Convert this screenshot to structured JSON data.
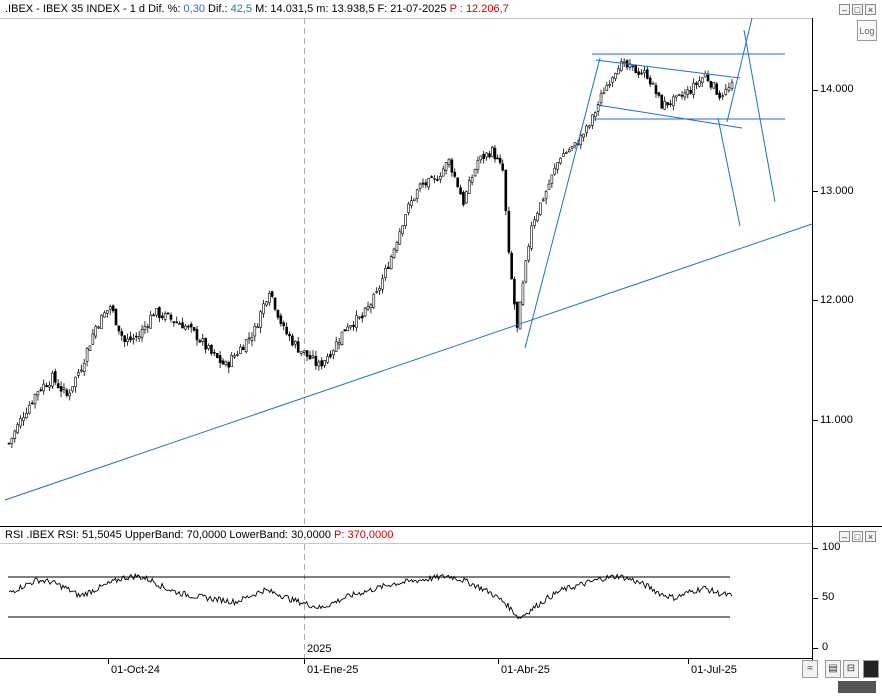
{
  "header": {
    "symbol": ".IBEX - IBEX 35 INDEX -  1 d",
    "dif_pct_label": "Dif. %:",
    "dif_pct": "0,30",
    "dif_label": "Dif.:",
    "dif": "42,5",
    "max": "M: 14.031,5",
    "min": "m: 13.938,5",
    "date": "F: 21-07-2025",
    "p_label": "P :",
    "p_value": "12.206,7"
  },
  "log_button": "Log",
  "rsi_header": {
    "text": "RSI .IBEX RSI: 51,5045  UpperBand: 70,0000  LowerBand: 30,0000",
    "p_label": "P:",
    "p_value": "370,0000"
  },
  "year_marker": "2025",
  "colors": {
    "trendline": "#1f6fd0",
    "price": "#000000",
    "red": "#d00000"
  },
  "chart_data": [
    {
      "type": "candlestick",
      "title": ".IBEX - IBEX 35 INDEX -  1 d",
      "y_ticks": [
        "14.000",
        "13.000",
        "12.000",
        "11.000"
      ],
      "y_tick_values": [
        14000,
        13000,
        12000,
        11000
      ],
      "x_ticks": [
        "01-Oct-24",
        "01-Ene-25",
        "01-Abr-25",
        "01-Jul-25"
      ],
      "ylim": [
        10000,
        14700
      ],
      "close_series": [
        {
          "date": "2024-08-05",
          "c": 10780
        },
        {
          "date": "2024-08-12",
          "c": 11050
        },
        {
          "date": "2024-08-19",
          "c": 11250
        },
        {
          "date": "2024-08-26",
          "c": 11350
        },
        {
          "date": "2024-09-02",
          "c": 11200
        },
        {
          "date": "2024-09-09",
          "c": 11450
        },
        {
          "date": "2024-09-16",
          "c": 11780
        },
        {
          "date": "2024-09-23",
          "c": 11950
        },
        {
          "date": "2024-09-30",
          "c": 11650
        },
        {
          "date": "2024-10-07",
          "c": 11700
        },
        {
          "date": "2024-10-14",
          "c": 11900
        },
        {
          "date": "2024-10-21",
          "c": 11850
        },
        {
          "date": "2024-10-28",
          "c": 11800
        },
        {
          "date": "2024-11-04",
          "c": 11700
        },
        {
          "date": "2024-11-11",
          "c": 11550
        },
        {
          "date": "2024-11-18",
          "c": 11450
        },
        {
          "date": "2024-11-25",
          "c": 11600
        },
        {
          "date": "2024-12-02",
          "c": 11750
        },
        {
          "date": "2024-12-09",
          "c": 12100
        },
        {
          "date": "2024-12-16",
          "c": 11750
        },
        {
          "date": "2024-12-23",
          "c": 11600
        },
        {
          "date": "2025-01-02",
          "c": 11450
        },
        {
          "date": "2025-01-09",
          "c": 11600
        },
        {
          "date": "2025-01-16",
          "c": 11800
        },
        {
          "date": "2025-01-23",
          "c": 11850
        },
        {
          "date": "2025-01-30",
          "c": 12050
        },
        {
          "date": "2025-02-06",
          "c": 12400
        },
        {
          "date": "2025-02-13",
          "c": 12800
        },
        {
          "date": "2025-02-20",
          "c": 13050
        },
        {
          "date": "2025-02-27",
          "c": 13100
        },
        {
          "date": "2025-03-06",
          "c": 13300
        },
        {
          "date": "2025-03-13",
          "c": 12900
        },
        {
          "date": "2025-03-20",
          "c": 13300
        },
        {
          "date": "2025-03-27",
          "c": 13400
        },
        {
          "date": "2025-04-01",
          "c": 13200
        },
        {
          "date": "2025-04-04",
          "c": 12400
        },
        {
          "date": "2025-04-08",
          "c": 11750
        },
        {
          "date": "2025-04-15",
          "c": 12700
        },
        {
          "date": "2025-04-22",
          "c": 13000
        },
        {
          "date": "2025-04-29",
          "c": 13350
        },
        {
          "date": "2025-05-06",
          "c": 13450
        },
        {
          "date": "2025-05-13",
          "c": 13650
        },
        {
          "date": "2025-05-20",
          "c": 14000
        },
        {
          "date": "2025-05-27",
          "c": 14250
        },
        {
          "date": "2025-06-03",
          "c": 14200
        },
        {
          "date": "2025-06-10",
          "c": 14150
        },
        {
          "date": "2025-06-17",
          "c": 13850
        },
        {
          "date": "2025-06-24",
          "c": 13900
        },
        {
          "date": "2025-07-01",
          "c": 14000
        },
        {
          "date": "2025-07-08",
          "c": 14150
        },
        {
          "date": "2025-07-15",
          "c": 13950
        },
        {
          "date": "2025-07-21",
          "c": 14030
        }
      ]
    },
    {
      "type": "line",
      "title": "RSI .IBEX RSI: 51,5045  UpperBand: 70,0000  LowerBand: 30,0000",
      "y_ticks": [
        "100",
        "50",
        "0"
      ],
      "y_tick_values": [
        100,
        50,
        0
      ],
      "ylim": [
        0,
        100
      ],
      "upper_band": 70,
      "lower_band": 30,
      "last_value": 51.5045,
      "rsi_series": [
        55,
        62,
        68,
        66,
        60,
        52,
        58,
        64,
        70,
        72,
        68,
        60,
        55,
        52,
        50,
        48,
        46,
        52,
        58,
        54,
        48,
        44,
        40,
        46,
        52,
        56,
        60,
        64,
        66,
        68,
        70,
        72,
        68,
        62,
        55,
        45,
        30,
        40,
        50,
        58,
        62,
        66,
        70,
        72,
        68,
        62,
        54,
        50,
        56,
        60,
        55,
        52
      ]
    }
  ]
}
